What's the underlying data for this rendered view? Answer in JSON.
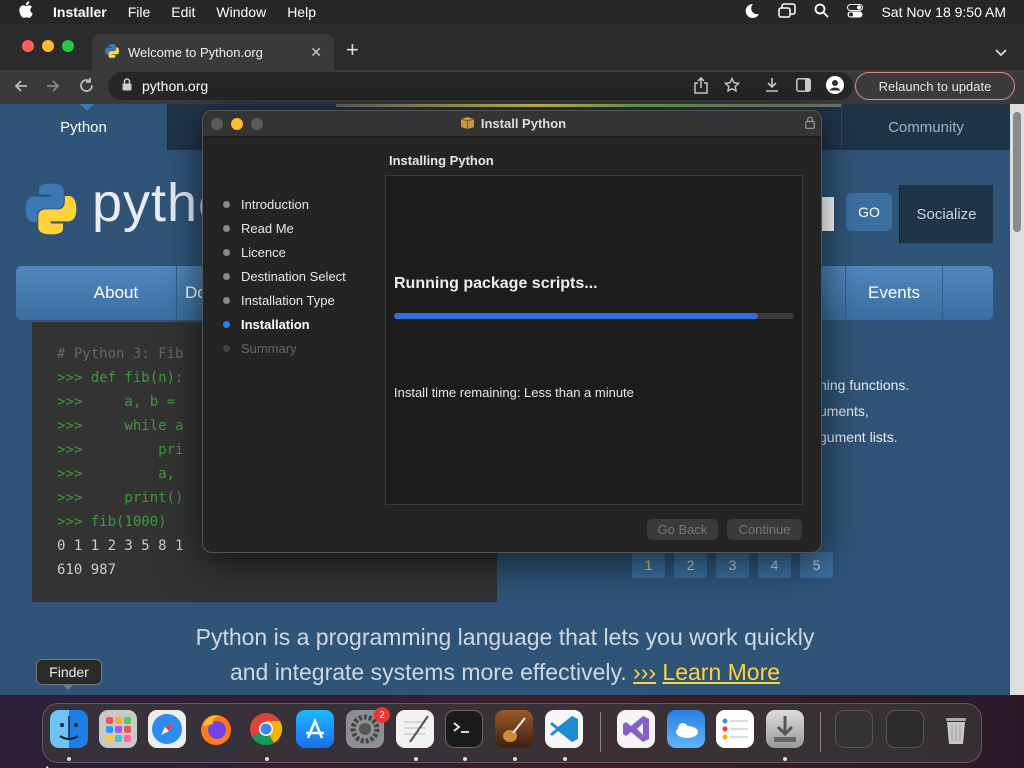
{
  "menubar": {
    "app_name": "Installer",
    "menus": [
      "File",
      "Edit",
      "Window",
      "Help"
    ],
    "datetime": "Sat Nov 18  9:50 AM"
  },
  "browser": {
    "tab_title": "Welcome to Python.org",
    "tab_close": "✕",
    "new_tab": "+",
    "url": "python.org",
    "relaunch_label": "Relaunch to update"
  },
  "site": {
    "nav_top": [
      "Python",
      "Community"
    ],
    "logo_text": "pytho",
    "go_label": "GO",
    "socialize_label": "Socialize",
    "nav_main": [
      "About",
      "Do",
      "Events"
    ],
    "code_lines": [
      "# Python 3: Fib",
      ">>> def fib(n):",
      ">>>     a, b =",
      ">>>     while a",
      ">>>         pri",
      ">>>         a,",
      ">>>     print()",
      ">>> fib(1000)",
      "0 1 1 2 3 5 8 1",
      "610 987"
    ],
    "desc_lines": [
      "ning functions.",
      "uments,",
      "gument lists."
    ],
    "pages": [
      "1",
      "2",
      "3",
      "4",
      "5"
    ],
    "tagline_1": "Python is a programming language that lets you work quickly",
    "tagline_2": "and integrate systems more effectively.",
    "learn_arrows": "›››",
    "learn_more": "Learn More"
  },
  "installer": {
    "title": "Install Python",
    "section_title": "Installing Python",
    "steps": [
      {
        "label": "Introduction",
        "state": "done"
      },
      {
        "label": "Read Me",
        "state": "done"
      },
      {
        "label": "Licence",
        "state": "done"
      },
      {
        "label": "Destination Select",
        "state": "done"
      },
      {
        "label": "Installation Type",
        "state": "done"
      },
      {
        "label": "Installation",
        "state": "current"
      },
      {
        "label": "Summary",
        "state": "pending"
      }
    ],
    "status": "Running package scripts...",
    "progress": 0.91,
    "time_remaining": "Install time remaining: Less than a minute",
    "go_back_label": "Go Back",
    "continue_label": "Continue"
  },
  "dock": {
    "tooltip": "Finder",
    "settings_badge": "2"
  },
  "colors": {
    "accent": "#2f6fdb",
    "python_blue": "#2f5477",
    "python_yellow": "#ffd43b"
  }
}
